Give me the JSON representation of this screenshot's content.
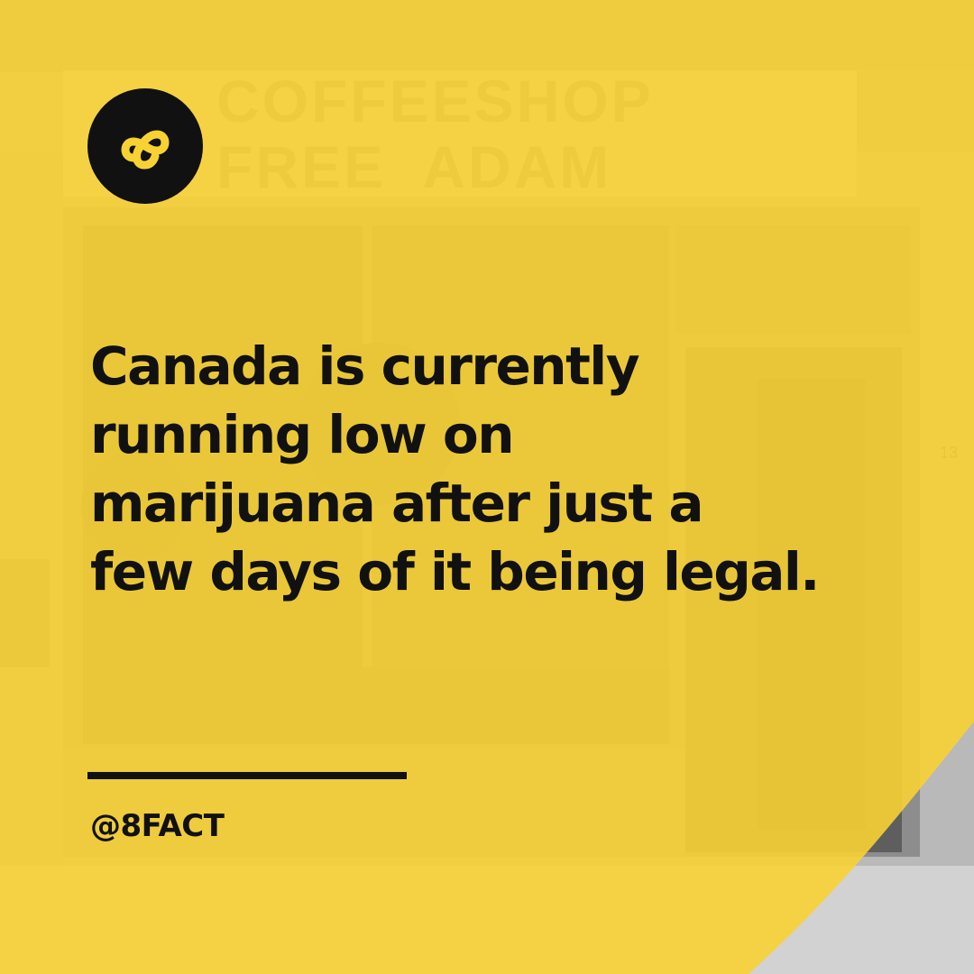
{
  "post": {
    "headline_lines": [
      "Canada is currently",
      "running low on",
      "marijuana after just a",
      "few days of it being legal."
    ],
    "handle": "@8FACT",
    "background_sign_lines": [
      "COFFEESHOP",
      "FREE  ADAM"
    ],
    "background_door_number": "13"
  },
  "logo": {
    "icon": "infinity-8-icon"
  },
  "colors": {
    "yellow": "#f7d23a",
    "ink": "#111111"
  }
}
